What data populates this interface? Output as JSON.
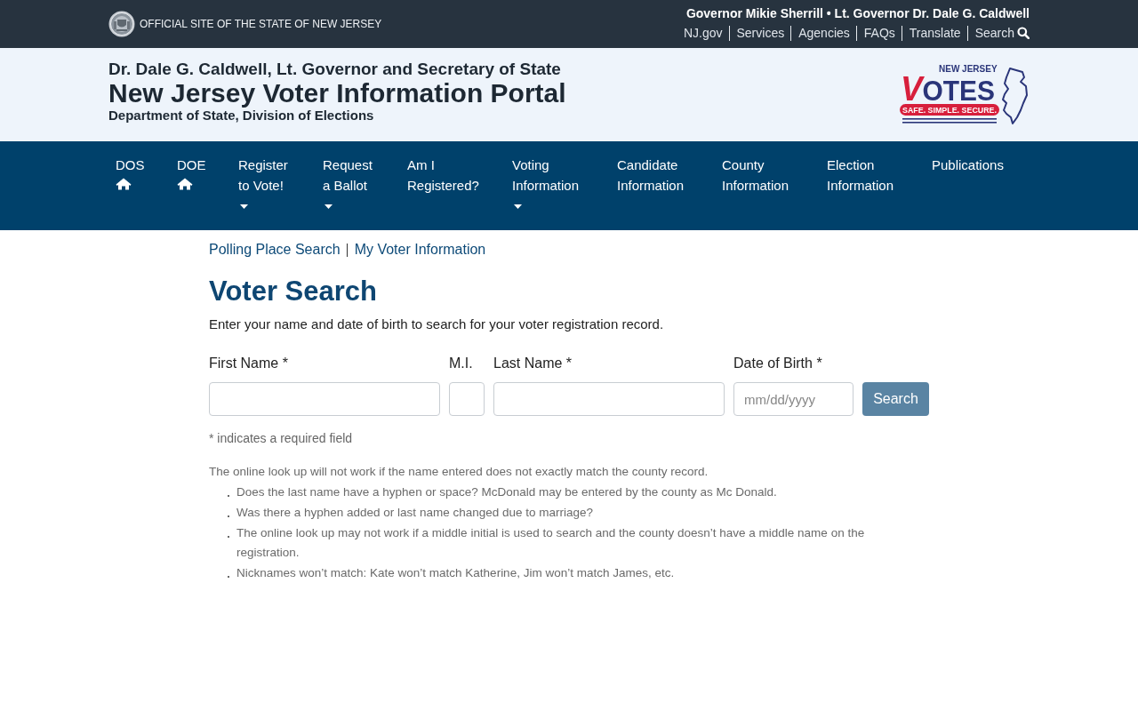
{
  "top_bar": {
    "official_label": "OFFICIAL SITE OF THE STATE OF NEW JERSEY",
    "officials": "Governor Mikie Sherrill • Lt. Governor Dr. Dale G. Caldwell",
    "links": [
      {
        "label": "NJ.gov",
        "kind": "link"
      },
      {
        "label": "Services",
        "kind": "link"
      },
      {
        "label": "Agencies",
        "kind": "link"
      },
      {
        "label": "FAQs",
        "kind": "link"
      },
      {
        "label": "Translate",
        "kind": "link"
      },
      {
        "label": "Search",
        "kind": "search"
      }
    ]
  },
  "masthead": {
    "kicker": "Dr. Dale G. Caldwell, Lt. Governor and Secretary of State",
    "title": "New Jersey Voter Information Portal",
    "department": "Department of State, Division of Elections",
    "logo": {
      "kicker": "NEW JERSEY",
      "wordmark": "VOTES",
      "tagline": "SAFE. SIMPLE. SECURE."
    }
  },
  "main_nav": {
    "items": [
      {
        "label": "DOS",
        "kind": "home"
      },
      {
        "label": "DOE",
        "kind": "home"
      },
      {
        "label": "Register to Vote!",
        "kind": "dropdown"
      },
      {
        "label": "Request a Ballot",
        "kind": "dropdown"
      },
      {
        "label": "Am I Registered?",
        "kind": "link"
      },
      {
        "label": "Voting Information",
        "kind": "dropdown"
      },
      {
        "label": "Candidate Information",
        "kind": "link"
      },
      {
        "label": "County Information",
        "kind": "link"
      },
      {
        "label": "Election Information",
        "kind": "link"
      },
      {
        "label": "Publications",
        "kind": "link"
      }
    ]
  },
  "subnav": {
    "links": [
      "Polling Place Search",
      "My Voter Information"
    ]
  },
  "page": {
    "title": "Voter Search",
    "intro": "Enter your name and date of birth to search for your voter registration record.",
    "fields": [
      {
        "label": "First Name *"
      },
      {
        "label": "M.I."
      },
      {
        "label": "Last Name *"
      },
      {
        "label": "Date of Birth *",
        "placeholder": "mm/dd/yyyy"
      }
    ],
    "search_button": "Search",
    "required_note": "* indicates a required field",
    "help": {
      "intro": "The online look up will not work if the name entered does not exactly match the county record.",
      "items": [
        "Does the last name have a hyphen or space? McDonald may be entered by the county as Mc Donald.",
        "Was there a hyphen added or last name changed due to marriage?",
        "The online look up may not work if a middle initial is used to search and the county doesn’t have a middle name on the registration.",
        "Nicknames won’t match: Kate won’t match Katherine, Jim won’t match James, etc."
      ]
    }
  }
}
